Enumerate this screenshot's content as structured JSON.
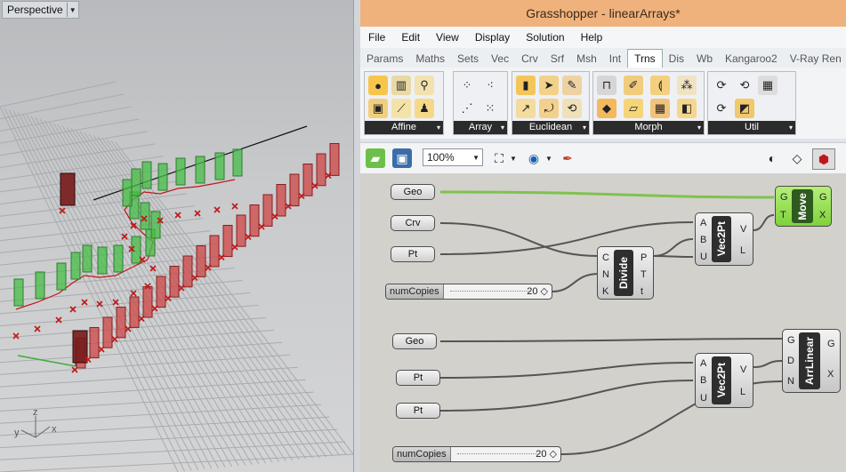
{
  "viewport": {
    "name": "Perspective",
    "axis_x": "x",
    "axis_y": "y",
    "axis_z": "z"
  },
  "grasshopper": {
    "title": "Grasshopper - linearArrays*",
    "menu": [
      "File",
      "Edit",
      "View",
      "Display",
      "Solution",
      "Help"
    ],
    "tabs": [
      "Params",
      "Maths",
      "Sets",
      "Vec",
      "Crv",
      "Srf",
      "Msh",
      "Int",
      "Trns",
      "Dis",
      "Wb",
      "Kangaroo2",
      "V-Ray Ren"
    ],
    "active_tab": "Trns",
    "panels": [
      {
        "label": "Affine",
        "icons": [
          "orient-icon",
          "mirror-icon",
          "bounds-icon",
          "scale-icon",
          "shear-icon",
          "rotate-icon"
        ]
      },
      {
        "label": "Array",
        "icons": [
          "curve-array-icon",
          "polar-array-icon",
          "linear-array-icon",
          "grid-array-icon"
        ]
      },
      {
        "label": "Euclidean",
        "icons": [
          "mirror-plane-icon",
          "move-icon",
          "rotate-axis-icon",
          "move-away-icon",
          "orient-direction-icon",
          "rotate-3d-icon"
        ]
      },
      {
        "label": "Morph",
        "icons": [
          "box-morph-icon",
          "surface-morph-icon",
          "bend-icon",
          "twist-icon",
          "map-surface-icon",
          "splop-icon",
          "box-map-icon",
          "flatten-icon"
        ]
      },
      {
        "label": "Util",
        "icons": [
          "compound-icon",
          "split-transform-icon",
          "transform-grid-icon",
          "inverse-transform-icon",
          "group-icon"
        ]
      }
    ],
    "zoom": "100%"
  },
  "canvas": {
    "params": {
      "geo1": "Geo",
      "crv": "Crv",
      "pt1": "Pt",
      "geo2": "Geo",
      "pt2": "Pt",
      "pt3": "Pt"
    },
    "slider1": {
      "name": "numCopies",
      "value": "20"
    },
    "slider2": {
      "name": "numCopies",
      "value": "20"
    },
    "divide": {
      "name": "Divide",
      "inputs": [
        "C",
        "N",
        "K"
      ],
      "outputs": [
        "P",
        "T",
        "t"
      ]
    },
    "vec2pt1": {
      "name": "Vec2Pt",
      "inputs": [
        "A",
        "B",
        "U"
      ],
      "outputs": [
        "V",
        "L"
      ]
    },
    "vec2pt2": {
      "name": "Vec2Pt",
      "inputs": [
        "A",
        "B",
        "U"
      ],
      "outputs": [
        "V",
        "L"
      ]
    },
    "move": {
      "name": "Move",
      "inputs": [
        "G",
        "T"
      ],
      "outputs": [
        "G",
        "X"
      ]
    },
    "arrlinear": {
      "name": "ArrLinear",
      "inputs": [
        "G",
        "D",
        "N"
      ],
      "outputs": [
        "G",
        "X"
      ]
    }
  }
}
